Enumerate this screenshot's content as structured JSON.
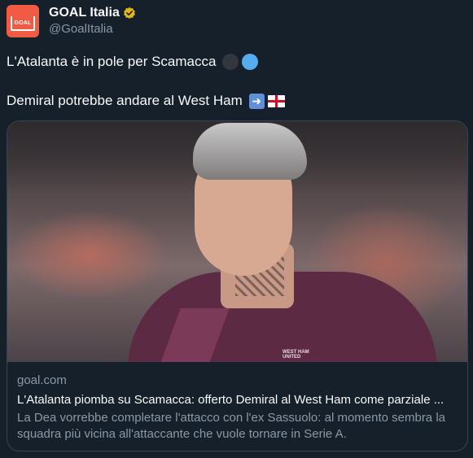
{
  "header": {
    "display_name": "GOAL Italia",
    "handle": "@GoalItalia",
    "avatar_text": "GOAL"
  },
  "tweet": {
    "line1": "L'Atalanta è in pole per Scamacca",
    "line2": "Demiral potrebbe andare al West Ham"
  },
  "card": {
    "image_icon": "player-photo",
    "crest_text": "WEST HAM UNITED",
    "domain": "goal.com",
    "title": "L'Atalanta piomba su Scamacca: offerto Demiral al West Ham come parziale ...",
    "description": "La Dea vorrebbe completare l'attacco con l'ex Sassuolo: al momento sembra la squadra più vicina all'attaccante che vuole tornare in Serie A."
  },
  "colors": {
    "background": "#15202b",
    "text": "#f7f9f9",
    "secondary": "#8b98a5",
    "avatar": "#f15b44",
    "verified": "#e2b719"
  }
}
